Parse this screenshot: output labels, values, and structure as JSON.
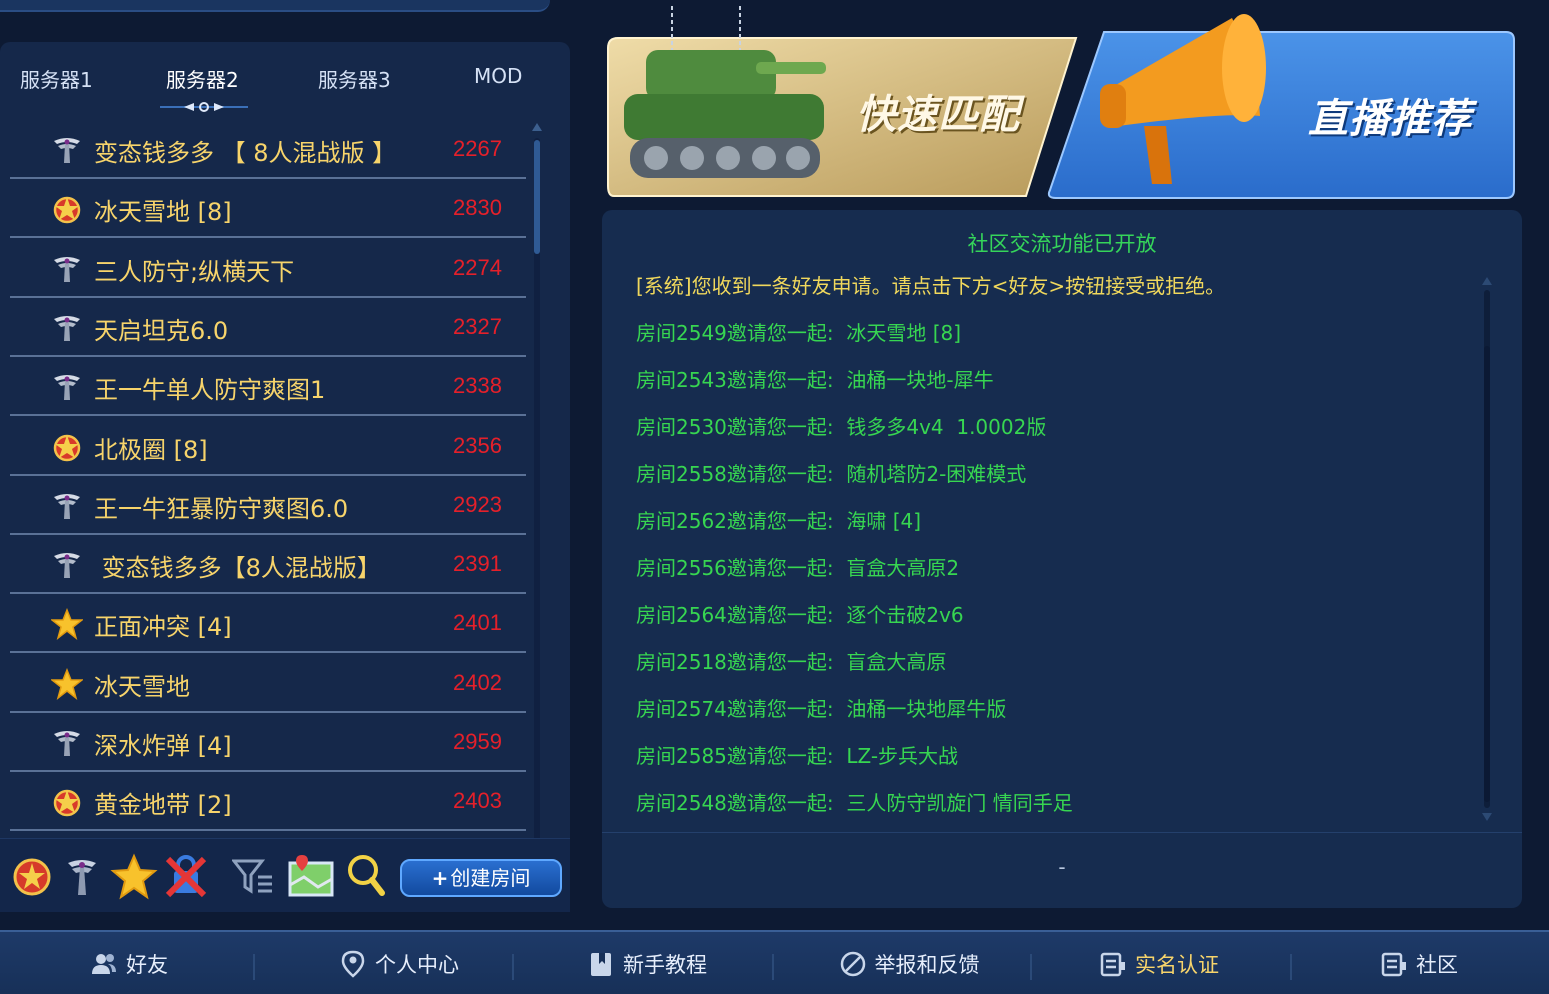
{
  "tabs": [
    {
      "label": "服务器1"
    },
    {
      "label": "服务器2"
    },
    {
      "label": "服务器3"
    },
    {
      "label": "MOD"
    }
  ],
  "rooms": [
    {
      "icon": "winged-emblem-icon",
      "name": "变态钱多多 【 8人混战版 】",
      "number": "2267"
    },
    {
      "icon": "red-star-badge-icon",
      "name": "冰天雪地 [8]",
      "number": "2830"
    },
    {
      "icon": "winged-emblem-icon",
      "name": "三人防守;纵横天下",
      "number": "2274"
    },
    {
      "icon": "winged-emblem-icon",
      "name": "天启坦克6.0",
      "number": "2327"
    },
    {
      "icon": "winged-emblem-icon",
      "name": "王一牛单人防守爽图1",
      "number": "2338"
    },
    {
      "icon": "red-star-badge-icon",
      "name": "北极圈 [8]",
      "number": "2356"
    },
    {
      "icon": "winged-emblem-icon",
      "name": "王一牛狂暴防守爽图6.0",
      "number": "2923"
    },
    {
      "icon": "winged-emblem-icon",
      "name": " 变态钱多多【8人混战版】",
      "number": "2391"
    },
    {
      "icon": "gold-star-icon",
      "name": "正面冲突 [4]",
      "number": "2401"
    },
    {
      "icon": "gold-star-icon",
      "name": "冰天雪地",
      "number": "2402"
    },
    {
      "icon": "winged-emblem-icon",
      "name": "深水炸弹 [4]",
      "number": "2959"
    },
    {
      "icon": "red-star-badge-icon",
      "name": "黄金地带 [2]",
      "number": "2403"
    }
  ],
  "toolbar": {
    "create_room": "创建房间"
  },
  "banners": {
    "quick_match": "快速匹配",
    "live_recommend": "直播推荐"
  },
  "chat": {
    "header": "社区交流功能已开放",
    "messages": [
      {
        "type": "system",
        "text": "[系统]您收到一条好友申请。请点击下方<好友>按钮接受或拒绝。"
      },
      {
        "type": "invite",
        "text": "房间2549邀请您一起:  冰天雪地 [8]"
      },
      {
        "type": "invite",
        "text": "房间2543邀请您一起:  油桶一块地-犀牛"
      },
      {
        "type": "invite",
        "text": "房间2530邀请您一起:  钱多多4v4  1.0002版"
      },
      {
        "type": "invite",
        "text": "房间2558邀请您一起:  随机塔防2-困难模式"
      },
      {
        "type": "invite",
        "text": "房间2562邀请您一起:  海啸 [4]"
      },
      {
        "type": "invite",
        "text": "房间2556邀请您一起:  盲盒大高原2"
      },
      {
        "type": "invite",
        "text": "房间2564邀请您一起:  逐个击破2v6"
      },
      {
        "type": "invite",
        "text": "房间2518邀请您一起:  盲盒大高原"
      },
      {
        "type": "invite",
        "text": "房间2574邀请您一起:  油桶一块地犀牛版"
      },
      {
        "type": "invite",
        "text": "房间2585邀请您一起:  LZ-步兵大战"
      },
      {
        "type": "invite",
        "text": "房间2548邀请您一起:  三人防守凯旋门 情同手足"
      }
    ],
    "input_text": "-"
  },
  "bottom_nav": [
    {
      "label": "好友",
      "icon": "friends-icon"
    },
    {
      "label": "个人中心",
      "icon": "profile-icon"
    },
    {
      "label": "新手教程",
      "icon": "tutorial-book-icon"
    },
    {
      "label": "举报和反馈",
      "icon": "report-icon"
    },
    {
      "label": "实名认证",
      "icon": "id-card-icon"
    },
    {
      "label": "社区",
      "icon": "community-icon"
    }
  ],
  "colors": {
    "room_name": "#f7d46b",
    "room_number": "#e5202a",
    "chat_invite": "#37d651",
    "chat_system": "#f0d85c"
  }
}
